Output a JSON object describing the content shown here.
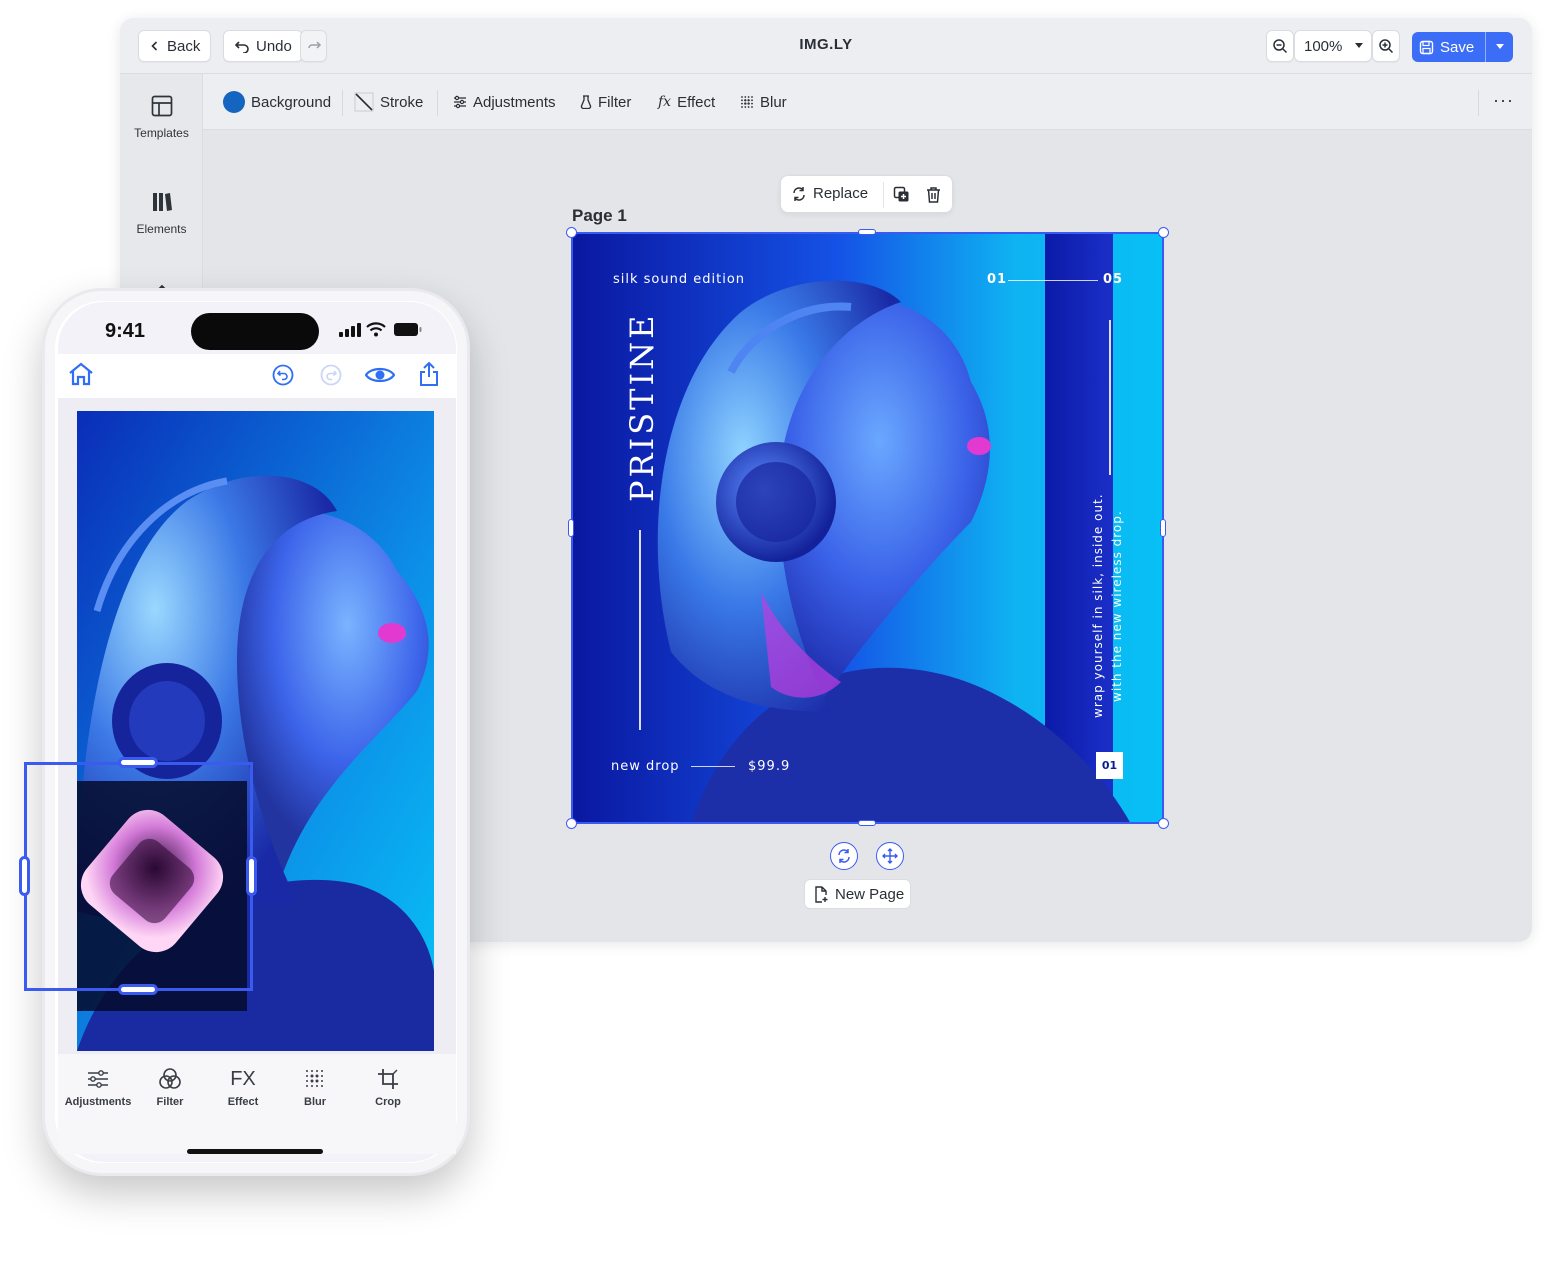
{
  "editor": {
    "app_name": "IMG.LY",
    "back_label": "Back",
    "undo_label": "Undo",
    "zoom_value": "100%",
    "save_label": "Save",
    "sidebar": [
      {
        "label": "Templates",
        "icon": "templates-icon"
      },
      {
        "label": "Elements",
        "icon": "elements-icon"
      },
      {
        "label": "",
        "icon": "upload-icon"
      }
    ],
    "toolbar": {
      "background_label": "Background",
      "background_color": "#1565c0",
      "stroke_label": "Stroke",
      "adjustments_label": "Adjustments",
      "filter_label": "Filter",
      "effect_label": "Effect",
      "blur_label": "Blur"
    },
    "page_label": "Page 1",
    "replace_label": "Replace",
    "new_page_label": "New Page",
    "accent_color": "#3b5bf0"
  },
  "poster": {
    "edition": "silk sound edition",
    "page_start": "01",
    "page_end": "05",
    "brand": "PRISTINE",
    "tagline_line1": "wrap yourself in silk, inside out.",
    "tagline_line2": "with the new wireless drop.",
    "drop_label": "new drop",
    "price": "$99.9",
    "badge": "01"
  },
  "phone": {
    "time": "9:41",
    "tabs": [
      {
        "label": "Adjustments",
        "icon": "adjustments-icon"
      },
      {
        "label": "Filter",
        "icon": "filter-icon"
      },
      {
        "label": "Effect",
        "icon": "fx-icon",
        "glyph": "FX"
      },
      {
        "label": "Blur",
        "icon": "blur-icon"
      },
      {
        "label": "Crop",
        "icon": "crop-icon"
      }
    ]
  }
}
